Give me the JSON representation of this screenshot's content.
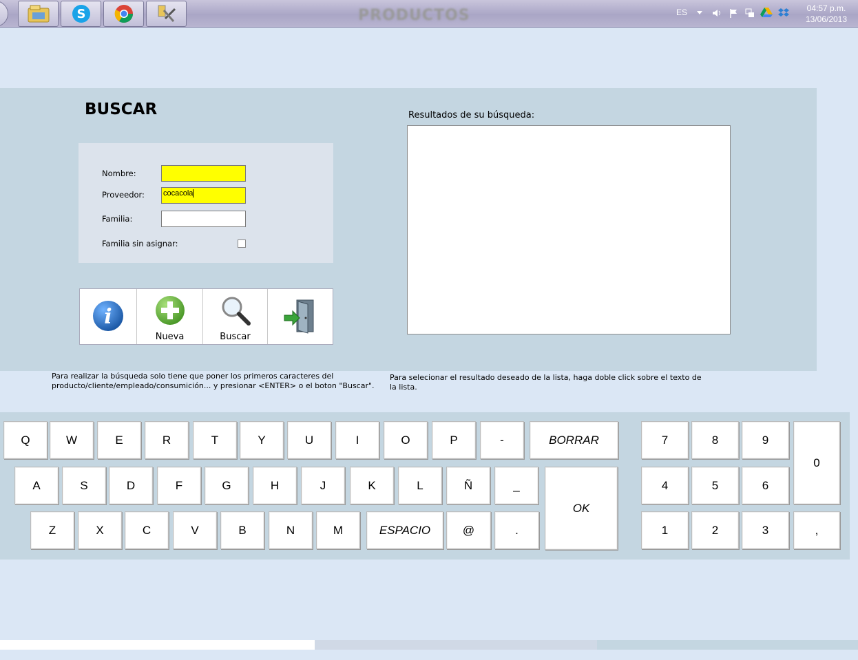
{
  "taskbar": {
    "window_title": "PRODUCTOS",
    "language": "ES",
    "time": "04:57 p.m.",
    "date": "13/06/2013",
    "apps": [
      "start-orb-icon",
      "file-explorer-icon",
      "skype-icon",
      "chrome-icon",
      "tools-app-icon"
    ]
  },
  "search": {
    "title": "BUSCAR",
    "nombre_label": "Nombre:",
    "nombre_value": "",
    "proveedor_label": "Proveedor:",
    "proveedor_value": "cocacola",
    "familia_label": "Familia:",
    "familia_value": "",
    "sin_asignar_label": "Familia sin asignar:"
  },
  "toolbar": {
    "info_label": "",
    "nueva_label": "Nueva",
    "buscar_label": "Buscar",
    "salir_label": ""
  },
  "results": {
    "label": "Resultados de su búsqueda:"
  },
  "help": {
    "left": "Para realizar la búsqueda solo tiene que poner los primeros caracteres del producto/cliente/empleado/consumición... y presionar <ENTER> o el boton \"Buscar\".",
    "right": "Para selecionar el resultado deseado de la lista, haga doble click sobre el texto de la lista."
  },
  "keyboard": {
    "row1": [
      "Q",
      "W",
      "E",
      "R",
      "T",
      "Y",
      "U",
      "I",
      "O",
      "P",
      "-"
    ],
    "borrar": "BORRAR",
    "row2": [
      "A",
      "S",
      "D",
      "F",
      "G",
      "H",
      "J",
      "K",
      "L",
      "Ñ",
      "_"
    ],
    "ok": "OK",
    "row3": [
      "Z",
      "X",
      "C",
      "V",
      "B",
      "N",
      "M"
    ],
    "espacio": "ESPACIO",
    "row3b": [
      "@",
      "."
    ],
    "numpad": [
      "7",
      "8",
      "9",
      "4",
      "5",
      "6",
      "1",
      "2",
      "3"
    ],
    "zero": "0",
    "comma": ","
  },
  "colors": {
    "panel": "#c4d6e1",
    "background": "#dbe7f5",
    "highlight_input": "#ffff00"
  }
}
